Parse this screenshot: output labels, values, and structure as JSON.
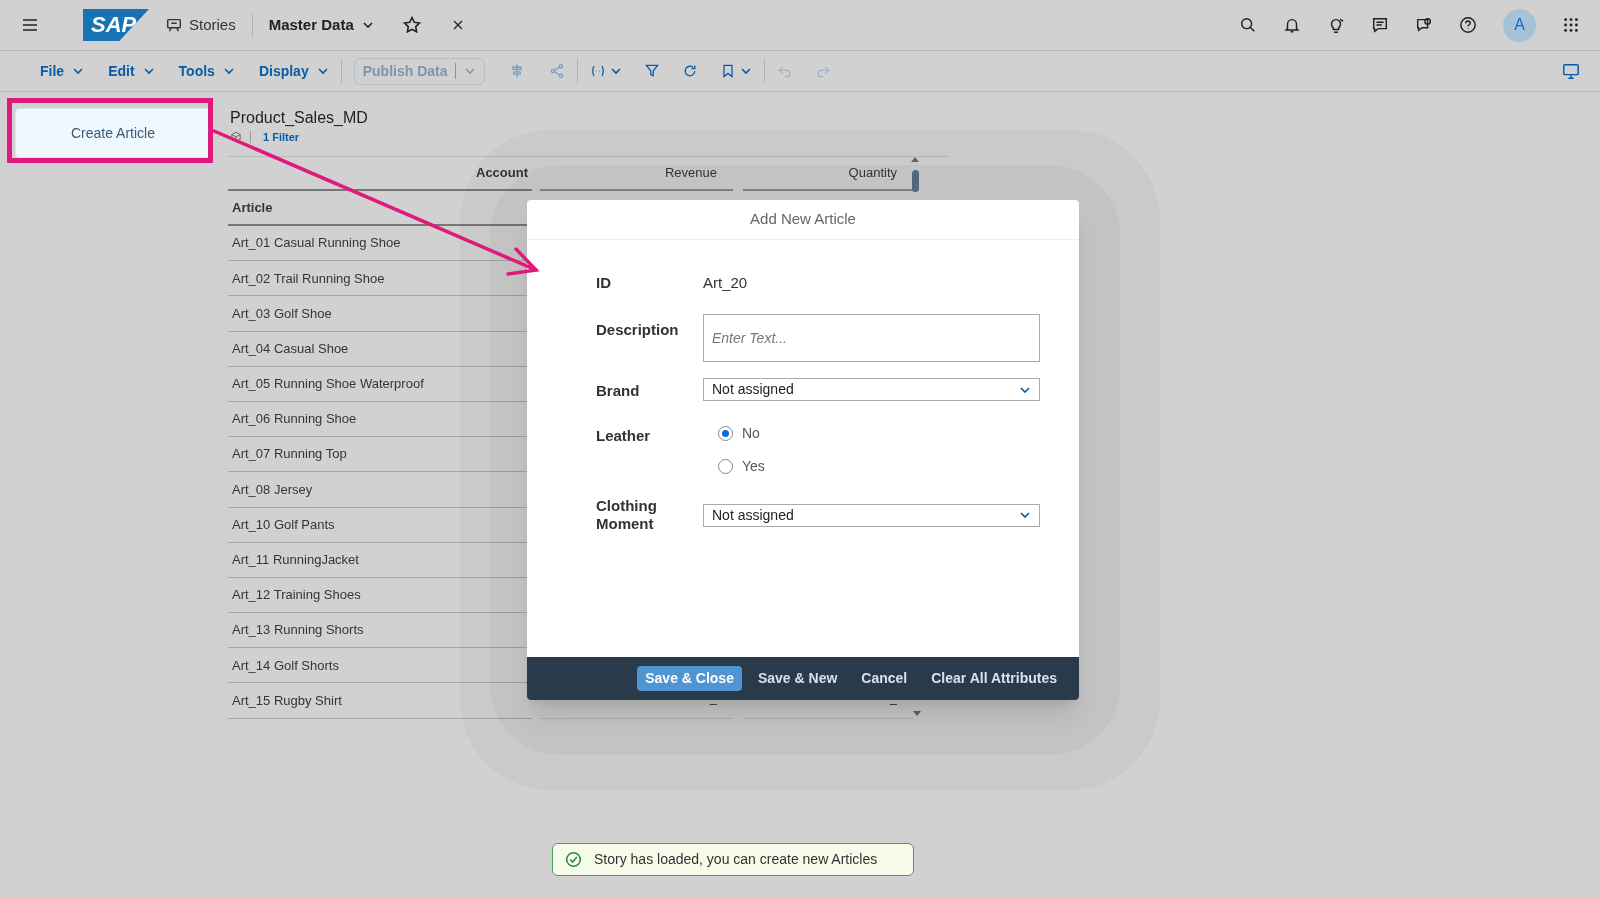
{
  "shell": {
    "logo": "SAP",
    "stories": "Stories",
    "title": "Master Data",
    "avatar": "A"
  },
  "menus": [
    {
      "label": "File"
    },
    {
      "label": "Edit"
    },
    {
      "label": "Tools"
    },
    {
      "label": "Display"
    }
  ],
  "publish": {
    "label": "Publish Data",
    "disabled": true
  },
  "create_button": "Create Article",
  "table": {
    "title": "Product_Sales_MD",
    "filter": "1 Filter",
    "account_header": "Account",
    "columns": [
      "Revenue",
      "Quantity"
    ],
    "row_header": "Article",
    "rows": [
      {
        "article": "Art_01 Casual Running Shoe"
      },
      {
        "article": "Art_02 Trail Running Shoe"
      },
      {
        "article": "Art_03 Golf Shoe"
      },
      {
        "article": "Art_04 Casual Shoe"
      },
      {
        "article": "Art_05 Running Shoe Waterproof"
      },
      {
        "article": "Art_06 Running Shoe"
      },
      {
        "article": "Art_07 Running Top"
      },
      {
        "article": "Art_08 Jersey"
      },
      {
        "article": "Art_10 Golf Pants"
      },
      {
        "article": "Art_11 RunningJacket"
      },
      {
        "article": "Art_12 Training Shoes"
      },
      {
        "article": "Art_13 Running Shorts"
      },
      {
        "article": "Art_14 Golf Shorts"
      },
      {
        "article": "Art_15 Rugby Shirt",
        "revenue": "–",
        "quantity": "–"
      }
    ]
  },
  "dialog": {
    "title": "Add New Article",
    "id_label": "ID",
    "id_value": "Art_20",
    "description_label": "Description",
    "description_placeholder": "Enter Text...",
    "brand_label": "Brand",
    "brand_value": "Not assigned",
    "leather_label": "Leather",
    "leather_options": [
      {
        "label": "No",
        "selected": true
      },
      {
        "label": "Yes",
        "selected": false
      }
    ],
    "clothing_label": "Clothing Moment",
    "clothing_value": "Not assigned",
    "buttons": [
      {
        "label": "Save & Close",
        "kind": "primary"
      },
      {
        "label": "Save & New",
        "kind": "plain"
      },
      {
        "label": "Cancel",
        "kind": "plain"
      },
      {
        "label": "Clear All Attributes",
        "kind": "plain"
      }
    ]
  },
  "toast": "Story has loaded, you can create new Articles"
}
